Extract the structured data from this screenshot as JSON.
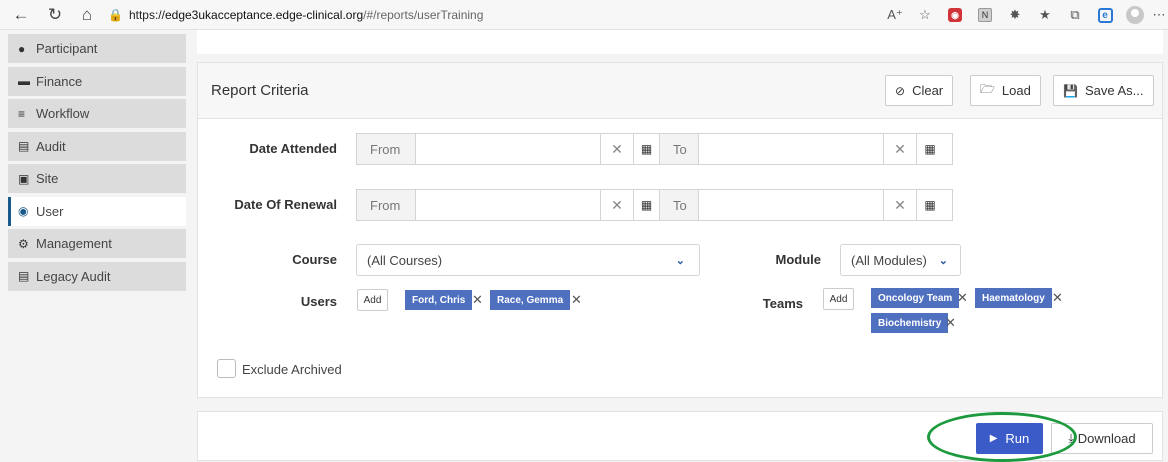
{
  "browser": {
    "url_prefix": "https://",
    "url_host": "edge3ukacceptance.edge-clinical.org",
    "url_path": "/#/reports/userTraining",
    "icons": [
      "back-icon",
      "reload-icon",
      "home-icon",
      "lock-icon",
      "read-aloud-icon",
      "favorite-add-icon",
      "extension-icon",
      "extension-n-icon",
      "extensions-icon",
      "favorites-icon",
      "collections-icon",
      "edge-icon",
      "profile-icon",
      "more-icon"
    ]
  },
  "sidebar": {
    "items": [
      {
        "label": "Participant",
        "icon": "person-icon"
      },
      {
        "label": "Finance",
        "icon": "wallet-icon"
      },
      {
        "label": "Workflow",
        "icon": "checklist-icon"
      },
      {
        "label": "Audit",
        "icon": "list-icon"
      },
      {
        "label": "Site",
        "icon": "hospital-icon"
      },
      {
        "label": "User",
        "icon": "users-icon",
        "active": true
      },
      {
        "label": "Management",
        "icon": "cog-icon"
      },
      {
        "label": "Legacy Audit",
        "icon": "list-icon"
      }
    ]
  },
  "panel": {
    "title": "Report Criteria",
    "clear_label": "Clear",
    "load_label": "Load",
    "save_as_label": "Save As..."
  },
  "form": {
    "date_attended_label": "Date Attended",
    "date_renewal_label": "Date Of Renewal",
    "from_label": "From",
    "to_label": "To",
    "course_label": "Course",
    "course_value": "(All Courses)",
    "module_label": "Module",
    "module_value": "(All Modules)",
    "users_label": "Users",
    "teams_label": "Teams",
    "add_label": "Add",
    "users": [
      "Ford, Chris",
      "Race, Gemma"
    ],
    "teams": [
      "Oncology Team",
      "Haematology",
      "Biochemistry"
    ],
    "exclude_archived_label": "Exclude Archived",
    "exclude_archived_checked": false
  },
  "actions": {
    "run_label": "Run",
    "download_label": "Download",
    "highlight_color": "#1d9a3d",
    "run_color": "#3b5bc9"
  }
}
